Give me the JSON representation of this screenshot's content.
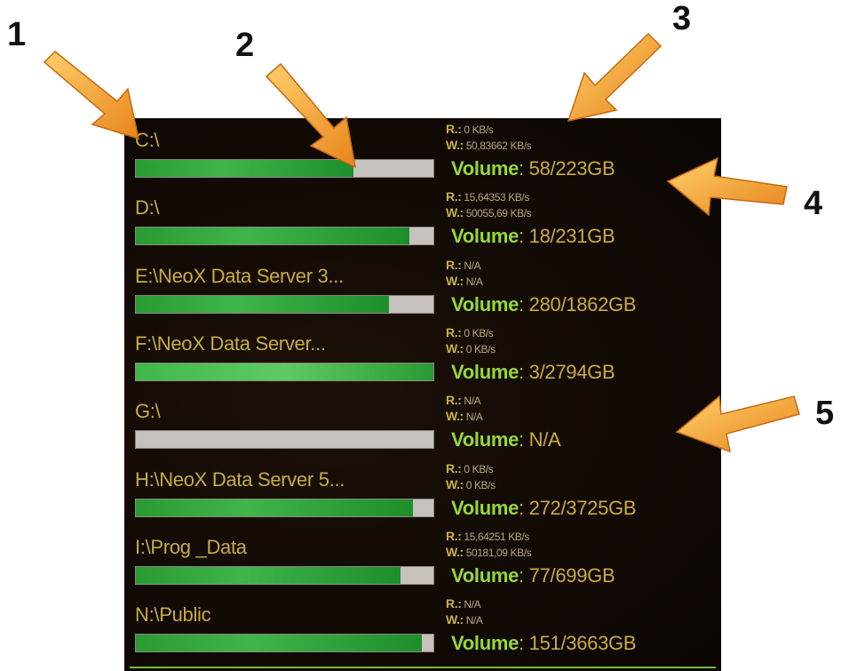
{
  "callouts": [
    "1",
    "2",
    "3",
    "4",
    "5"
  ],
  "colors": {
    "background": "#120a05",
    "label": "#c9ad3e",
    "volume_key": "#96d83a",
    "bar_fill": "#2a9a32",
    "bar_empty": "#c7c2be",
    "arrow": "#f5a02a"
  },
  "drives": [
    {
      "label": "C:\\",
      "usage_fraction": 0.73,
      "read_key": "R.:",
      "read": "0 KB/s",
      "write_key": "W.:",
      "write": "50,83662 KB/s",
      "volume_key": "Volume",
      "volume": ": 58/223GB"
    },
    {
      "label": "D:\\",
      "usage_fraction": 0.92,
      "read_key": "R.:",
      "read": "15,64353 KB/s",
      "write_key": "W.:",
      "write": "50055,69 KB/s",
      "volume_key": "Volume",
      "volume": ": 18/231GB"
    },
    {
      "label": "E:\\NeoX Data Server 3...",
      "usage_fraction": 0.85,
      "read_key": "R.:",
      "read": "N/A",
      "write_key": "W.:",
      "write": "N/A",
      "volume_key": "Volume",
      "volume": ": 280/1862GB"
    },
    {
      "label": "F:\\NeoX Data Server...",
      "usage_fraction": 1.0,
      "read_key": "R.:",
      "read": "0 KB/s",
      "write_key": "W.:",
      "write": "0 KB/s",
      "volume_key": "Volume",
      "volume": ": 3/2794GB"
    },
    {
      "label": "G:\\",
      "usage_fraction": 0.0,
      "read_key": "R.:",
      "read": "N/A",
      "write_key": "W.:",
      "write": "N/A",
      "volume_key": "Volume",
      "volume": ": N/A"
    },
    {
      "label": "H:\\NeoX Data Server 5...",
      "usage_fraction": 0.93,
      "read_key": "R.:",
      "read": "0 KB/s",
      "write_key": "W.:",
      "write": "0 KB/s",
      "volume_key": "Volume",
      "volume": ": 272/3725GB"
    },
    {
      "label": "I:\\Prog _Data",
      "usage_fraction": 0.89,
      "read_key": "R.:",
      "read": "15,64251 KB/s",
      "write_key": "W.:",
      "write": "50181,09 KB/s",
      "volume_key": "Volume",
      "volume": ": 77/699GB"
    },
    {
      "label": "N:\\Public",
      "usage_fraction": 0.96,
      "read_key": "R.:",
      "read": "N/A",
      "write_key": "W.:",
      "write": "N/A",
      "volume_key": "Volume",
      "volume": ": 151/3663GB"
    }
  ]
}
